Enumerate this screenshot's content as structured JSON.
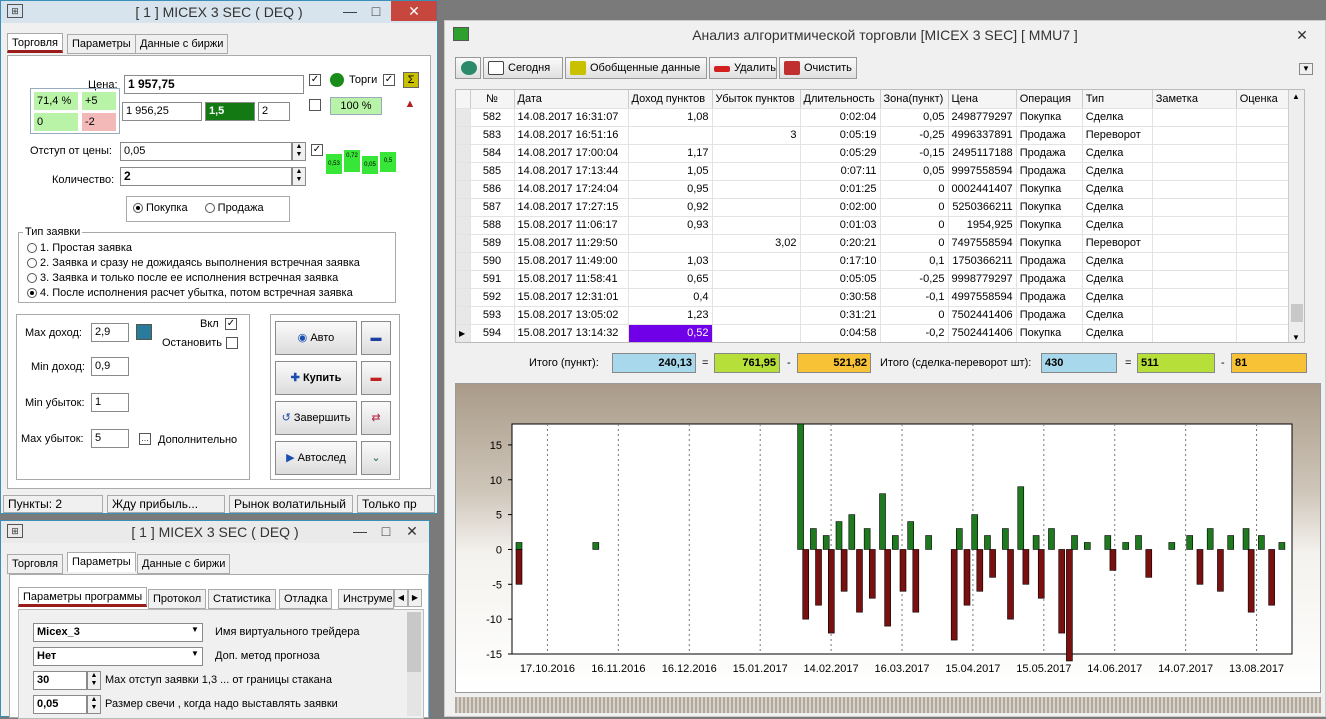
{
  "w1": {
    "title": "[ 1 ]       MICEX 3 SEC ( DEQ )",
    "tabs": [
      "Торговля",
      "Параметры",
      "Данные с биржи"
    ],
    "price_label": "Цена:",
    "price": "1 957,75",
    "pct": "71,4 %",
    "plus": "+5",
    "zero": "0",
    "minus": "-2",
    "bid": "1 956,25",
    "green_val": "1,5",
    "small_val": "2",
    "trade_label": "Торги",
    "hundred": "100 %",
    "offset_label": "Отступ от цены:",
    "offset": "0,05",
    "qty_label": "Количество:",
    "qty": "2",
    "mini_boxes": [
      "0,53",
      "0,72",
      "0,05",
      "0,5"
    ],
    "buy_label": "Покупка",
    "sell_label": "Продажа",
    "order_type_label": "Тип заявки",
    "order_types": [
      "1. Простая заявка",
      "2. Заявка и сразу не дожидаясь выполнения встречная заявка",
      "3. Заявка и только после ее исполнения встречная заявка",
      "4. После  исполнения  расчет убытка, потом встречная заявка"
    ],
    "max_income_label": "Max доход:",
    "max_income": "2,9",
    "vkl": "Вкл",
    "stop_label": "Остановить",
    "min_income_label": "Min доход:",
    "min_income": "0,9",
    "min_loss_label": "Min убыток:",
    "min_loss": "1",
    "max_loss_label": "Max убыток:",
    "max_loss": "5",
    "extra_label": "Дополнительно",
    "btn_auto": "Авто",
    "btn_buy": "Купить",
    "btn_finish": "Завершить",
    "btn_autofollow": "Автослед",
    "status": [
      "Пункты: 2",
      "Жду прибыль...",
      "Рынок волатильный",
      "Только пр"
    ]
  },
  "w2": {
    "title": "[ 1 ]       MICEX 3 SEC ( DEQ )",
    "tabs": [
      "Торговля",
      "Параметры",
      "Данные с биржи"
    ],
    "subtabs": [
      "Параметры программы",
      "Протокол",
      "Статистика",
      "Отладка",
      "Инструме"
    ],
    "rows": [
      {
        "value": "Micex_3",
        "label": "Имя виртуального трейдера"
      },
      {
        "value": "Нет",
        "label": "Доп. метод прогноза"
      },
      {
        "value": "30",
        "label": "Max отступ заявки 1,3 ... от границы стакана"
      },
      {
        "value": "0,05",
        "label": "Размер свечи , когда надо выставлять заявки"
      }
    ]
  },
  "w3": {
    "title": "Анализ алгоритмической торговли [MICEX 3 SEC] [ MMU7 ]",
    "toolbar": [
      "Сегодня",
      "Обобщенные данные",
      "Удалить",
      "Очистить"
    ],
    "columns": [
      "№",
      "Дата",
      "Доход  пунктов",
      "Убыток пунктов",
      "Длительность",
      "Зона(пункт)",
      "Цена",
      "Операция",
      "Тип",
      "Заметка",
      "Оценка"
    ],
    "rows": [
      [
        "582",
        "14.08.2017 16:31:07",
        "1,08",
        "",
        "0:02:04",
        "0,05",
        "2498779297",
        "Покупка",
        "Сделка"
      ],
      [
        "583",
        "14.08.2017 16:51:16",
        "",
        "3",
        "0:05:19",
        "-0,25",
        "4996337891",
        "Продажа",
        "Переворот"
      ],
      [
        "584",
        "14.08.2017 17:00:04",
        "1,17",
        "",
        "0:05:29",
        "-0,15",
        "2495117188",
        "Продажа",
        "Сделка"
      ],
      [
        "585",
        "14.08.2017 17:13:44",
        "1,05",
        "",
        "0:07:11",
        "0,05",
        "9997558594",
        "Продажа",
        "Сделка"
      ],
      [
        "586",
        "14.08.2017 17:24:04",
        "0,95",
        "",
        "0:01:25",
        "0",
        "0002441407",
        "Покупка",
        "Сделка"
      ],
      [
        "587",
        "14.08.2017 17:27:15",
        "0,92",
        "",
        "0:02:00",
        "0",
        "5250366211",
        "Покупка",
        "Сделка"
      ],
      [
        "588",
        "15.08.2017 11:06:17",
        "0,93",
        "",
        "0:01:03",
        "0",
        "1954,925",
        "Покупка",
        "Сделка"
      ],
      [
        "589",
        "15.08.2017 11:29:50",
        "",
        "3,02",
        "0:20:21",
        "0",
        "7497558594",
        "Покупка",
        "Переворот"
      ],
      [
        "590",
        "15.08.2017 11:49:00",
        "1,03",
        "",
        "0:17:10",
        "0,1",
        "1750366211",
        "Продажа",
        "Сделка"
      ],
      [
        "591",
        "15.08.2017 11:58:41",
        "0,65",
        "",
        "0:05:05",
        "-0,25",
        "9998779297",
        "Продажа",
        "Сделка"
      ],
      [
        "592",
        "15.08.2017 12:31:01",
        "0,4",
        "",
        "0:30:58",
        "-0,1",
        "4997558594",
        "Продажа",
        "Сделка"
      ],
      [
        "593",
        "15.08.2017 13:05:02",
        "1,23",
        "",
        "0:31:21",
        "0",
        "7502441406",
        "Продажа",
        "Сделка"
      ],
      [
        "594",
        "15.08.2017 13:14:32",
        "0,52",
        "",
        "0:04:58",
        "-0,2",
        "7502441406",
        "Покупка",
        "Сделка"
      ]
    ],
    "sum_label": "Итого (пункт):",
    "sum_total": "240,13",
    "sum_eq": "=",
    "sum_income": "761,95",
    "sum_minus": "-",
    "sum_loss": "521,82",
    "cnt_label": "Итого (сделка-переворот шт):",
    "cnt_total": "430",
    "cnt_eq": "=",
    "cnt_deals": "511",
    "cnt_minus": "-",
    "cnt_rev": "81"
  },
  "chart_data": {
    "type": "bar",
    "ylim": [
      -15,
      18
    ],
    "yticks": [
      15,
      10,
      5,
      0,
      -5,
      -10,
      -15
    ],
    "xticks": [
      "17.10.2016",
      "16.11.2016",
      "16.12.2016",
      "15.01.2017",
      "14.02.2017",
      "16.03.2017",
      "15.04.2017",
      "15.05.2017",
      "14.06.2017",
      "14.07.2017",
      "13.08.2017"
    ],
    "x_range": [
      0,
      300
    ],
    "bars": [
      [
        0,
        -5,
        "loss"
      ],
      [
        0,
        1,
        "gain"
      ],
      [
        30,
        1,
        "gain"
      ],
      [
        110,
        18,
        "gain"
      ],
      [
        112,
        -10,
        "loss"
      ],
      [
        115,
        3,
        "gain"
      ],
      [
        117,
        -8,
        "loss"
      ],
      [
        120,
        2,
        "gain"
      ],
      [
        122,
        -12,
        "loss"
      ],
      [
        125,
        4,
        "gain"
      ],
      [
        127,
        -6,
        "loss"
      ],
      [
        130,
        5,
        "gain"
      ],
      [
        133,
        -9,
        "loss"
      ],
      [
        136,
        3,
        "gain"
      ],
      [
        138,
        -7,
        "loss"
      ],
      [
        142,
        8,
        "gain"
      ],
      [
        144,
        -11,
        "loss"
      ],
      [
        147,
        2,
        "gain"
      ],
      [
        150,
        -6,
        "loss"
      ],
      [
        153,
        4,
        "gain"
      ],
      [
        155,
        -9,
        "loss"
      ],
      [
        160,
        2,
        "gain"
      ],
      [
        170,
        -13,
        "loss"
      ],
      [
        172,
        3,
        "gain"
      ],
      [
        175,
        -8,
        "loss"
      ],
      [
        178,
        5,
        "gain"
      ],
      [
        180,
        -6,
        "loss"
      ],
      [
        183,
        2,
        "gain"
      ],
      [
        185,
        -4,
        "loss"
      ],
      [
        190,
        3,
        "gain"
      ],
      [
        192,
        -10,
        "loss"
      ],
      [
        196,
        9,
        "gain"
      ],
      [
        198,
        -5,
        "loss"
      ],
      [
        202,
        2,
        "gain"
      ],
      [
        204,
        -7,
        "loss"
      ],
      [
        208,
        3,
        "gain"
      ],
      [
        212,
        -12,
        "loss"
      ],
      [
        215,
        -16,
        "loss"
      ],
      [
        217,
        2,
        "gain"
      ],
      [
        222,
        1,
        "gain"
      ],
      [
        230,
        2,
        "gain"
      ],
      [
        232,
        -3,
        "loss"
      ],
      [
        237,
        1,
        "gain"
      ],
      [
        242,
        2,
        "gain"
      ],
      [
        246,
        -4,
        "loss"
      ],
      [
        255,
        1,
        "gain"
      ],
      [
        262,
        2,
        "gain"
      ],
      [
        266,
        -5,
        "loss"
      ],
      [
        270,
        3,
        "gain"
      ],
      [
        274,
        -6,
        "loss"
      ],
      [
        278,
        2,
        "gain"
      ],
      [
        284,
        3,
        "gain"
      ],
      [
        286,
        -9,
        "loss"
      ],
      [
        290,
        2,
        "gain"
      ],
      [
        294,
        -8,
        "loss"
      ],
      [
        298,
        1,
        "gain"
      ]
    ],
    "gain_color": "#1f7a1f",
    "loss_color": "#7a1010"
  }
}
